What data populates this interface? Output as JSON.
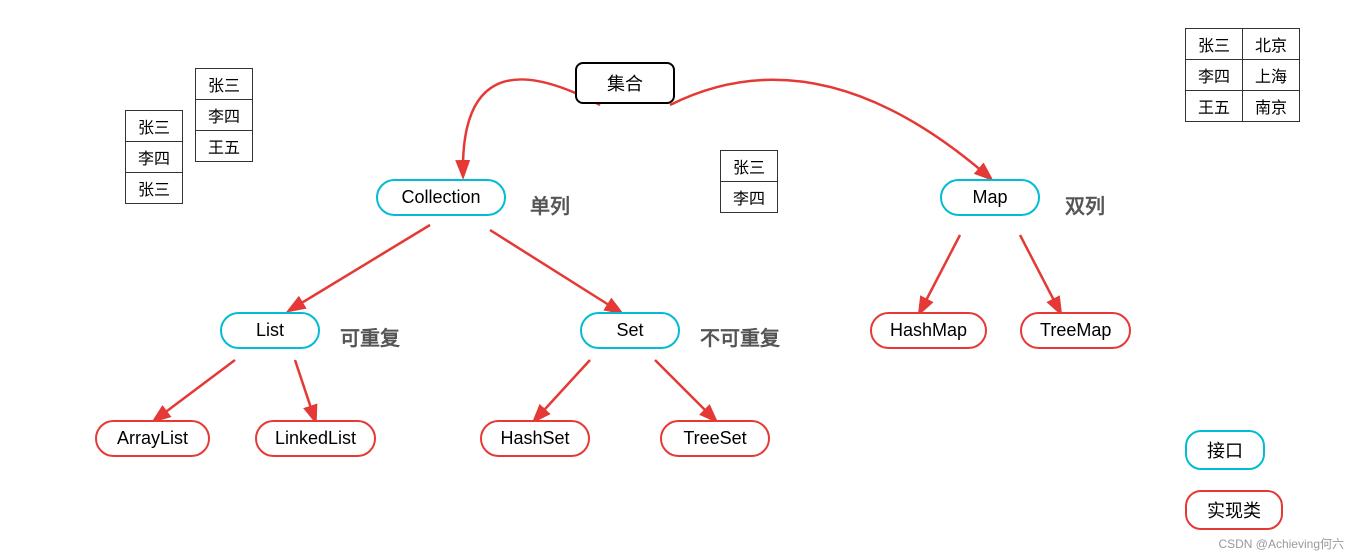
{
  "nodes": {
    "jihe": {
      "label": "集合"
    },
    "collection": {
      "label": "Collection"
    },
    "map": {
      "label": "Map"
    },
    "list": {
      "label": "List"
    },
    "set": {
      "label": "Set"
    },
    "hashmap": {
      "label": "HashMap"
    },
    "treemap": {
      "label": "TreeMap"
    },
    "arraylist": {
      "label": "ArrayList"
    },
    "linkedlist": {
      "label": "LinkedList"
    },
    "hashset": {
      "label": "HashSet"
    },
    "treeset": {
      "label": "TreeSet"
    }
  },
  "labels": {
    "single": "单列",
    "double": "双列",
    "repeatable": "可重复",
    "not_repeatable": "不可重复"
  },
  "tables": {
    "top_right": [
      [
        "张三",
        "北京"
      ],
      [
        "李四",
        "上海"
      ],
      [
        "王五",
        "南京"
      ]
    ],
    "top_left_back": [
      [
        "张三"
      ],
      [
        "李四"
      ],
      [
        "王五"
      ]
    ],
    "top_left_front": [
      [
        "张三"
      ],
      [
        "李四"
      ],
      [
        "张三"
      ]
    ],
    "middle_right": [
      [
        "张三"
      ],
      [
        "李四"
      ]
    ]
  },
  "legend": {
    "interface": "接口",
    "implementation": "实现类"
  },
  "watermark": "CSDN @Achieving何六"
}
